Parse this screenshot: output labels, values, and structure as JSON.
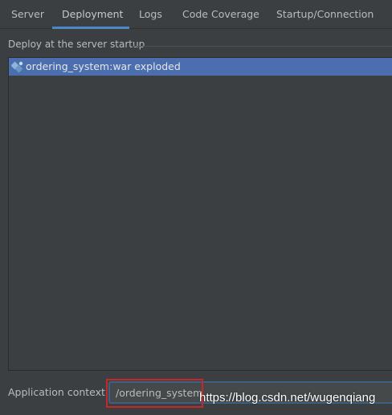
{
  "tabs": [
    {
      "label": "Server",
      "active": false
    },
    {
      "label": "Deployment",
      "active": true
    },
    {
      "label": "Logs",
      "active": false
    },
    {
      "label": "Code Coverage",
      "active": false
    },
    {
      "label": "Startup/Connection",
      "active": false
    }
  ],
  "deploy": {
    "title": "Deploy at the server startup",
    "items": [
      {
        "label": "ordering_system:war exploded",
        "icon": "artifact-icon",
        "selected": true
      }
    ]
  },
  "context": {
    "label": "Application context:",
    "value": "/ordering_system"
  },
  "watermark": "https://blog.csdn.net/wugenqiang",
  "colors": {
    "background": "#3c3f41",
    "selection": "#4b6eaf",
    "tab_underline": "#4a88c7",
    "highlight_box": "#c62828"
  }
}
